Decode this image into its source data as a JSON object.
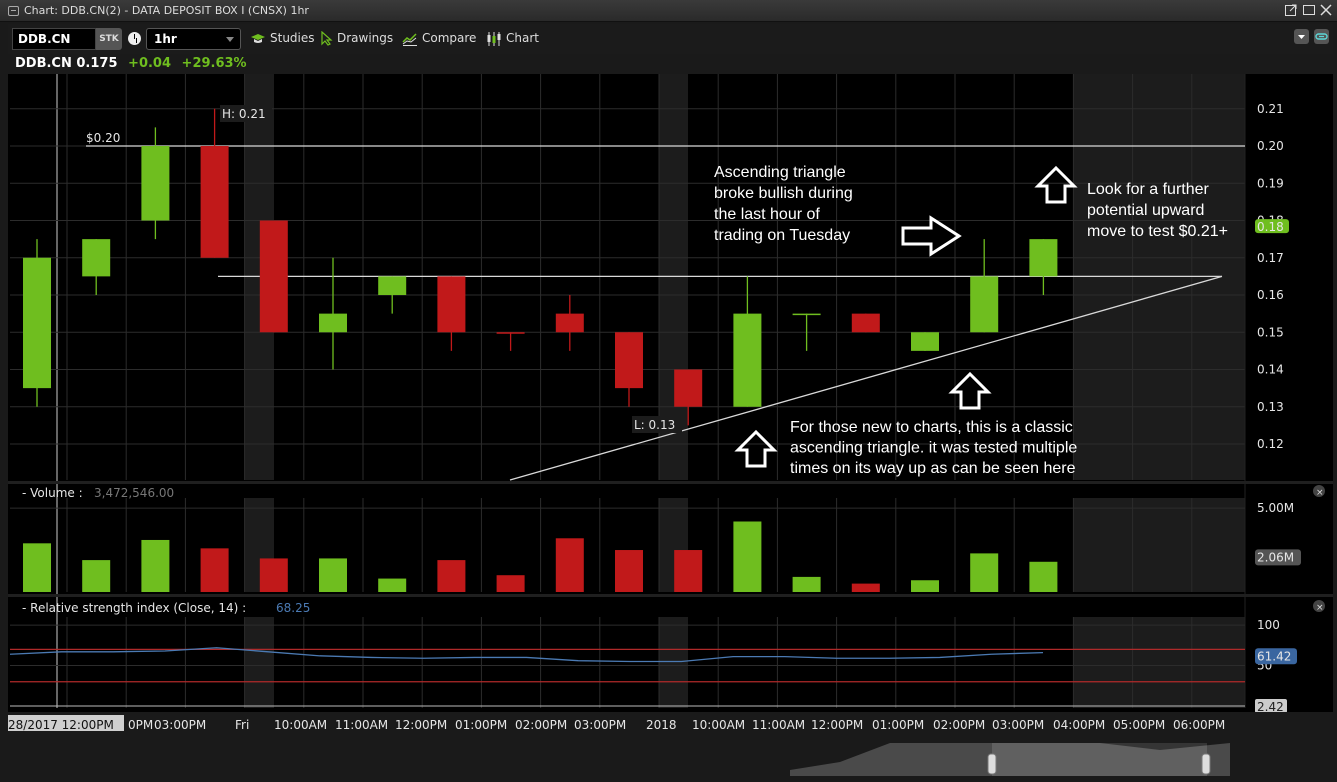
{
  "window": {
    "title": "Chart: DDB.CN(2) - DATA DEPOSIT BOX I (CNSX) 1hr",
    "buttons": [
      "popout-icon",
      "maximize-icon",
      "close-icon"
    ]
  },
  "toolbar": {
    "symbol": "DDB.CN",
    "security_type": "STK",
    "interval": "1hr",
    "studies_label": "Studies",
    "drawings_label": "Drawings",
    "compare_label": "Compare",
    "chart_label": "Chart"
  },
  "quote": {
    "symbol": "DDB.CN",
    "last": "0.175",
    "change": "+0.04",
    "change_pct": "+29.63%"
  },
  "colors": {
    "up": "#6fbe1f",
    "down": "#c1191a",
    "rsi_line": "#4b7ab3",
    "rsi_band": "#b02a2a",
    "grid": "#2c2c2c",
    "session_shade": "#1c1c1c"
  },
  "chart_data": [
    {
      "type": "candlestick",
      "title": "DDB.CN 1hr",
      "ylim": [
        0.11,
        0.215
      ],
      "yticks": [
        "0.12",
        "0.13",
        "0.14",
        "0.15",
        "0.16",
        "0.17",
        "0.18",
        "0.19",
        "0.20",
        "0.21"
      ],
      "last_price_badge": "0.18",
      "high_label": "H: 0.21",
      "low_label": "L: 0.13",
      "resistance_label": "$0.20",
      "resistance": 0.2,
      "triangle_top": 0.165,
      "candles": [
        {
          "o": 0.135,
          "h": 0.175,
          "l": 0.13,
          "c": 0.17
        },
        {
          "o": 0.165,
          "h": 0.175,
          "l": 0.16,
          "c": 0.175
        },
        {
          "o": 0.18,
          "h": 0.205,
          "l": 0.175,
          "c": 0.2
        },
        {
          "o": 0.2,
          "h": 0.21,
          "l": 0.17,
          "c": 0.17
        },
        {
          "o": 0.18,
          "h": 0.18,
          "l": 0.15,
          "c": 0.15
        },
        {
          "o": 0.15,
          "h": 0.17,
          "l": 0.14,
          "c": 0.155
        },
        {
          "o": 0.16,
          "h": 0.165,
          "l": 0.155,
          "c": 0.165
        },
        {
          "o": 0.165,
          "h": 0.165,
          "l": 0.145,
          "c": 0.15
        },
        {
          "o": 0.15,
          "h": 0.15,
          "l": 0.145,
          "c": 0.15,
          "dir": "down"
        },
        {
          "o": 0.155,
          "h": 0.16,
          "l": 0.145,
          "c": 0.15
        },
        {
          "o": 0.15,
          "h": 0.15,
          "l": 0.13,
          "c": 0.135
        },
        {
          "o": 0.14,
          "h": 0.14,
          "l": 0.125,
          "c": 0.13
        },
        {
          "o": 0.13,
          "h": 0.165,
          "l": 0.13,
          "c": 0.155
        },
        {
          "o": 0.155,
          "h": 0.155,
          "l": 0.145,
          "c": 0.155,
          "dir": "up"
        },
        {
          "o": 0.155,
          "h": 0.155,
          "l": 0.15,
          "c": 0.15
        },
        {
          "o": 0.145,
          "h": 0.15,
          "l": 0.145,
          "c": 0.15
        },
        {
          "o": 0.15,
          "h": 0.175,
          "l": 0.15,
          "c": 0.165
        },
        {
          "o": 0.165,
          "h": 0.175,
          "l": 0.16,
          "c": 0.175
        }
      ],
      "annotations": [
        {
          "lines": [
            "Ascending triangle",
            "broke bullish during",
            "the last hour of",
            "trading on Tuesday"
          ]
        },
        {
          "lines": [
            "Look for a further",
            "potential upward",
            "move to test $0.21+"
          ]
        },
        {
          "lines": [
            "For those new to charts, this is a classic",
            "ascending triangle. it was tested multiple",
            "times on its way up as can be seen here"
          ]
        }
      ]
    },
    {
      "type": "bar",
      "title": "Volume",
      "value_label": "3,472,546.00",
      "ylim": [
        0,
        5.6
      ],
      "unit": "M",
      "ytick": "5.00M",
      "last_badge": "2.06M",
      "values": [
        2.9,
        1.9,
        3.1,
        2.6,
        2.0,
        2.0,
        0.8,
        1.9,
        1.0,
        3.2,
        2.5,
        2.5,
        4.2,
        0.9,
        0.5,
        0.7,
        2.3,
        1.8
      ],
      "directions": [
        "up",
        "up",
        "up",
        "down",
        "down",
        "up",
        "up",
        "down",
        "down",
        "down",
        "down",
        "down",
        "up",
        "up",
        "down",
        "up",
        "up",
        "up"
      ]
    },
    {
      "type": "line",
      "title": "Relative strength index (Close, 14)",
      "value_label": "68.25",
      "ylim": [
        0,
        110
      ],
      "yticks": [
        "100",
        "50"
      ],
      "bands": [
        70,
        30
      ],
      "last_badge": "61.42",
      "bottom_badge": "2.42",
      "values": [
        64,
        67,
        67,
        68,
        72,
        67,
        62,
        60,
        59,
        60,
        60,
        56,
        55,
        55,
        61,
        61,
        59,
        59,
        60,
        64,
        66
      ]
    }
  ],
  "time_axis": {
    "labels": [
      "28/2017 12:00PM",
      "0PM",
      "03:00PM",
      "Fri",
      "10:00AM",
      "11:00AM",
      "12:00PM",
      "01:00PM",
      "02:00PM",
      "03:00PM",
      "2018",
      "10:00AM",
      "11:00AM",
      "12:00PM",
      "01:00PM",
      "02:00PM",
      "03:00PM",
      "04:00PM",
      "05:00PM",
      "06:00PM"
    ]
  },
  "panels": {
    "volume_prefix": "- Volume :",
    "rsi_prefix": "- Relative strength index (Close, 14) :"
  }
}
